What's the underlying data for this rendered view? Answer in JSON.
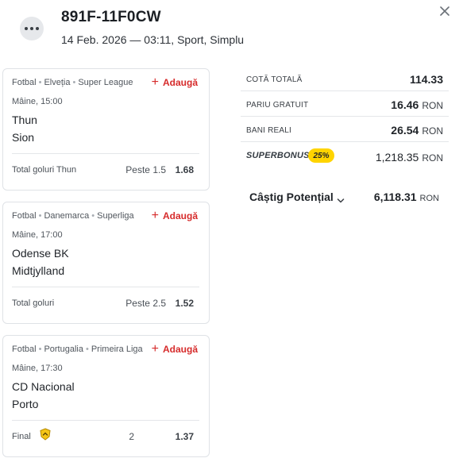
{
  "header": {
    "ticket_id": "891F-11F0CW",
    "subtitle": "14 Feb. 2026 — 03:11, Sport, Simplu"
  },
  "colors": {
    "accent": "#d62b2b",
    "badge": "#ffd400",
    "border": "#dfe2e6"
  },
  "icons": {
    "menu": "more-dots-icon",
    "close": "close-icon",
    "add": "plus-icon",
    "expand": "chevron-down-icon",
    "final": "shield-badge-icon"
  },
  "add_label": "Adaugă",
  "events": [
    {
      "sport": "Fotbal",
      "country": "Elveția",
      "league": "Super League",
      "time": "Mâine, 15:00",
      "team1": "Thun",
      "team2": "Sion",
      "market": "Total goluri Thun",
      "pick": "Peste 1.5",
      "odd": "1.68"
    },
    {
      "sport": "Fotbal",
      "country": "Danemarca",
      "league": "Superliga",
      "time": "Mâine, 17:00",
      "team1": "Odense BK",
      "team2": "Midtjylland",
      "market": "Total goluri",
      "pick": "Peste 2.5",
      "odd": "1.52"
    },
    {
      "sport": "Fotbal",
      "country": "Portugalia",
      "league": "Primeira Liga",
      "time": "Mâine, 17:30",
      "team1": "CD Nacional",
      "team2": "Porto",
      "market": "Final",
      "pick": "2",
      "odd": "1.37"
    }
  ],
  "summary": {
    "total_odds_label": "COTĂ TOTALĂ",
    "total_odds": "114.33",
    "free_bet_label": "PARIU GRATUIT",
    "free_bet": "16.46",
    "real_money_label": "BANI REALI",
    "real_money": "26.54",
    "currency": "RON",
    "superbonus_label": "SUPERBONUS",
    "superbonus_pct": "25%",
    "superbonus_value": "1,218.35",
    "potential_win_label": "Câștig Potențial",
    "potential_win": "6,118.31"
  }
}
